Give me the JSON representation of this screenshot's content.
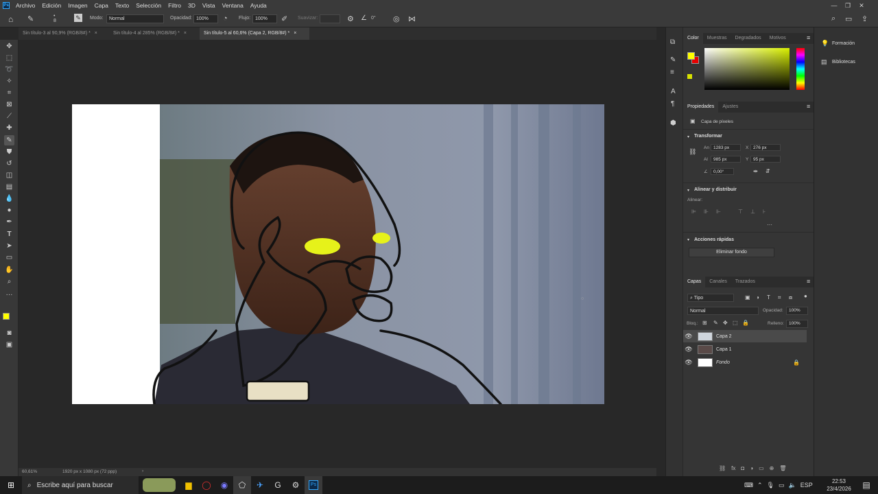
{
  "menubar": {
    "logo": "Ps",
    "items": [
      "Archivo",
      "Edición",
      "Imagen",
      "Capa",
      "Texto",
      "Selección",
      "Filtro",
      "3D",
      "Vista",
      "Ventana",
      "Ayuda"
    ]
  },
  "options": {
    "mode_label": "Modo:",
    "mode_value": "Normal",
    "opacity_label": "Opacidad:",
    "opacity_value": "100%",
    "flow_label": "Flujo:",
    "flow_value": "100%",
    "smooth_label": "Suavizar:",
    "angle_value": "0°"
  },
  "doc_tabs": [
    {
      "label": "Sin título-3 al 90,9% (RGB/8#) *"
    },
    {
      "label": "Sin título-4 al 285% (RGB/8#) *"
    },
    {
      "label": "Sin título-5 al 60,6% (Capa 2, RGB/8#) *"
    }
  ],
  "status": {
    "zoom": "60,61%",
    "doc_info": "1920 px x 1080 px (72 ppp)"
  },
  "color_panel": {
    "tabs": [
      "Color",
      "Muestras",
      "Degradados",
      "Motivos"
    ],
    "foreground": "#ffff00",
    "background": "#e60000"
  },
  "properties": {
    "tabs": [
      "Propiedades",
      "Ajustes"
    ],
    "layer_type": "Capa de píxeles",
    "transform_title": "Transformar",
    "w_label": "An",
    "w_value": "1283 px",
    "x_label": "X",
    "x_value": "276 px",
    "h_label": "Al",
    "h_value": "985 px",
    "y_label": "Y",
    "y_value": "95 px",
    "angle_value": "0,00°",
    "align_title": "Alinear y distribuir",
    "align_label": "Alinear:",
    "quick_title": "Acciones rápidas",
    "remove_bg": "Eliminar fondo"
  },
  "layers_panel": {
    "tabs": [
      "Capas",
      "Canales",
      "Trazados"
    ],
    "filter": "Tipo",
    "blend": "Normal",
    "opacity_label": "Opacidad:",
    "opacity_value": "100%",
    "lock_label": "Bloq.:",
    "fill_label": "Relleno:",
    "fill_value": "100%",
    "layers": [
      {
        "name": "Capa 2"
      },
      {
        "name": "Capa 1"
      },
      {
        "name": "Fondo"
      }
    ]
  },
  "right_column": {
    "learn": "Formación",
    "libraries": "Bibliotecas"
  },
  "taskbar": {
    "search_placeholder": "Escribe aquí para buscar",
    "lang": "ESP",
    "time": "22:53",
    "date": "23/4/2026"
  }
}
